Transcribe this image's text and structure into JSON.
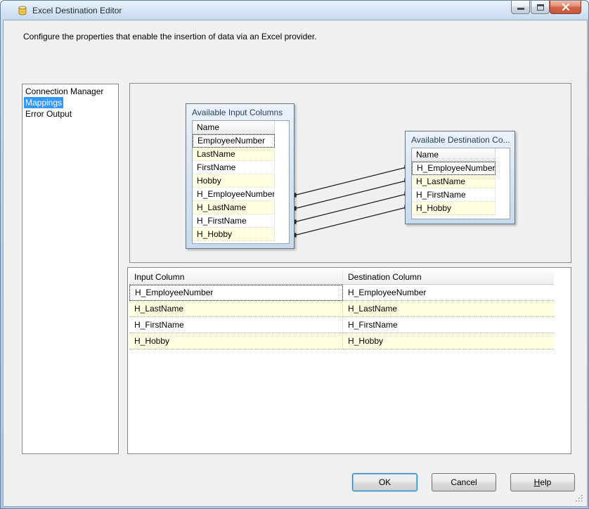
{
  "window": {
    "title": "Excel Destination Editor"
  },
  "description": "Configure the properties that enable the insertion of data via an Excel provider.",
  "sidebar": {
    "items": [
      {
        "label": "Connection Manager",
        "selected": false
      },
      {
        "label": "Mappings",
        "selected": true
      },
      {
        "label": "Error Output",
        "selected": false
      }
    ]
  },
  "diagram": {
    "input_box": {
      "title": "Available Input Columns",
      "header": "Name",
      "rows": [
        {
          "label": "EmployeeNumber",
          "focused": true
        },
        {
          "label": "LastName",
          "focused": false
        },
        {
          "label": "FirstName",
          "focused": false
        },
        {
          "label": "Hobby",
          "focused": false
        },
        {
          "label": "H_EmployeeNumber",
          "focused": false
        },
        {
          "label": "H_LastName",
          "focused": false
        },
        {
          "label": "H_FirstName",
          "focused": false
        },
        {
          "label": "H_Hobby",
          "focused": false
        }
      ]
    },
    "destination_box": {
      "title": "Available Destination Co...",
      "header": "Name",
      "rows": [
        {
          "label": "H_EmployeeNumber",
          "focused": true
        },
        {
          "label": "H_LastName",
          "focused": false
        },
        {
          "label": "H_FirstName",
          "focused": false
        },
        {
          "label": "H_Hobby",
          "focused": false
        }
      ]
    },
    "connections": [
      {
        "from": "H_EmployeeNumber",
        "to": "H_EmployeeNumber"
      },
      {
        "from": "H_LastName",
        "to": "H_LastName"
      },
      {
        "from": "H_FirstName",
        "to": "H_FirstName"
      },
      {
        "from": "H_Hobby",
        "to": "H_Hobby"
      }
    ]
  },
  "mapping_table": {
    "columns": [
      "Input Column",
      "Destination Column"
    ],
    "rows": [
      {
        "input": "H_EmployeeNumber",
        "destination": "H_EmployeeNumber"
      },
      {
        "input": "H_LastName",
        "destination": "H_LastName"
      },
      {
        "input": "H_FirstName",
        "destination": "H_FirstName"
      },
      {
        "input": "H_Hobby",
        "destination": "H_Hobby"
      }
    ]
  },
  "buttons": {
    "ok": "OK",
    "cancel": "Cancel",
    "help_accel": "H",
    "help_rest": "elp"
  },
  "colors": {
    "highlight": "#3399FF",
    "row_alt": "#FFFFE1",
    "titlebar": "#D8E6F6",
    "frame": "#BDD2E9"
  }
}
